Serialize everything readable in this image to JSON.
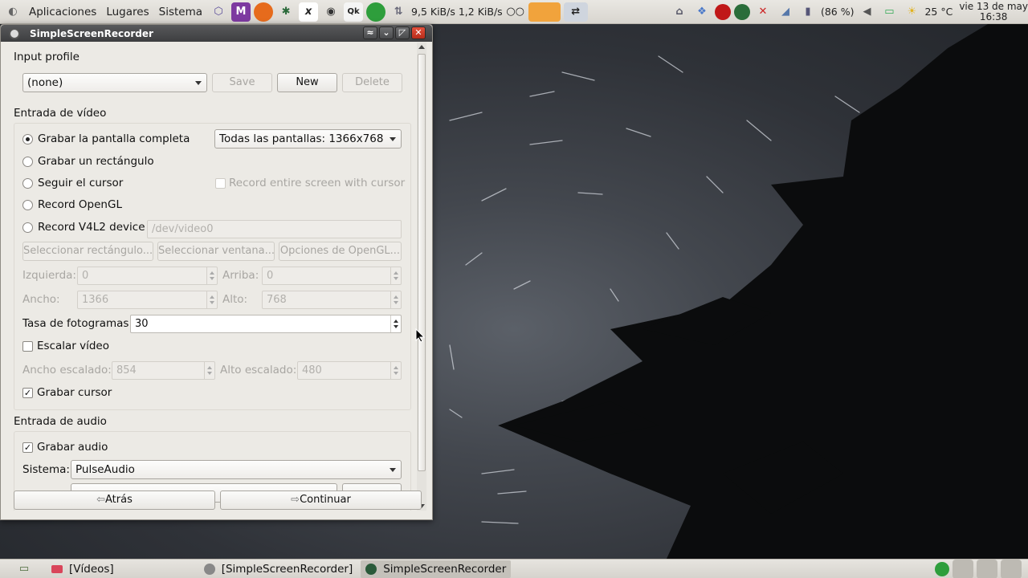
{
  "top_panel": {
    "menus": [
      "Aplicaciones",
      "Lugares",
      "Sistema"
    ],
    "net_down": "9,5 KiB/s",
    "net_up": "1,2 KiB/s",
    "battery": "(86 %)",
    "temperature": "25 °C",
    "date": "vie 13 de may",
    "time": "16:38"
  },
  "window": {
    "title": "SimpleScreenRecorder",
    "input_profile": {
      "title": "Input profile",
      "profile_value": "(none)",
      "save_label": "Save",
      "new_label": "New",
      "delete_label": "Delete"
    },
    "video": {
      "title": "Entrada de vídeo",
      "record_fullscreen": "Grabar la pantalla completa",
      "screens_value": "Todas las pantallas: 1366x768",
      "record_rect": "Grabar un rectángulo",
      "follow_cursor": "Seguir el cursor",
      "record_entire_with_cursor": "Record entire screen with cursor",
      "record_opengl": "Record OpenGL",
      "record_v4l2": "Record V4L2 device",
      "v4l2_device": "/dev/video0",
      "select_rect": "Seleccionar rectángulo...",
      "select_window": "Seleccionar ventana...",
      "opengl_options": "Opciones de OpenGL...",
      "left_label": "Izquierda:",
      "left_value": "0",
      "top_label": "Arriba:",
      "top_value": "0",
      "width_label": "Ancho:",
      "width_value": "1366",
      "height_label": "Alto:",
      "height_value": "768",
      "framerate_label": "Tasa de fotogramas:",
      "framerate_value": "30",
      "scale_video": "Escalar vídeo",
      "scaled_width_label": "Ancho escalado:",
      "scaled_width_value": "854",
      "scaled_height_label": "Alto escalado:",
      "scaled_height_value": "480",
      "record_cursor": "Grabar cursor"
    },
    "audio": {
      "title": "Entrada de audio",
      "record_audio": "Grabar audio",
      "system_label": "Sistema:",
      "system_value": "PulseAudio"
    },
    "footer": {
      "back_label": "Atrás",
      "continue_label": "Continuar"
    }
  },
  "taskbar": {
    "items": [
      "[Vídeos]",
      "[SimpleScreenRecorder]",
      "SimpleScreenRecorder"
    ]
  }
}
